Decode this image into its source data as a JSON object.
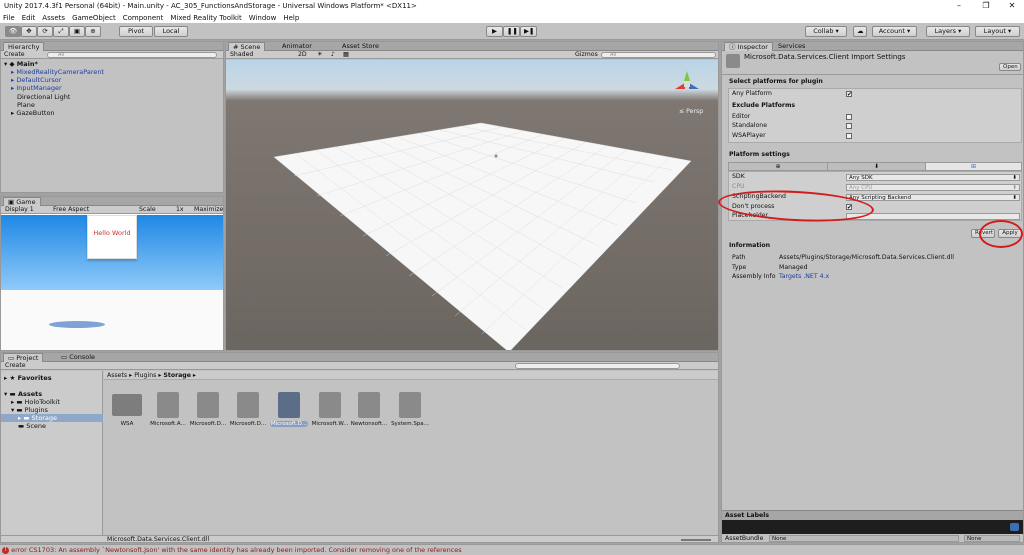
{
  "title": "Unity 2017.4.3f1 Personal (64bit) - Main.unity - AC_305_FunctionsAndStorage - Universal Windows Platform* <DX11>",
  "menu": [
    "File",
    "Edit",
    "Assets",
    "GameObject",
    "Component",
    "Mixed Reality Toolkit",
    "Window",
    "Help"
  ],
  "toolbar": {
    "pivot": "Pivot",
    "local": "Local",
    "collab": "Collab",
    "account": "Account",
    "layers": "Layers",
    "layout": "Layout"
  },
  "hierarchy": {
    "tab": "Hierarchy",
    "create": "Create",
    "search_placeholder": "All",
    "scene": "Main*",
    "items": [
      {
        "label": "MixedRealityCameraParent",
        "blue": true,
        "arrow": true
      },
      {
        "label": "DefaultCursor",
        "blue": true,
        "arrow": true
      },
      {
        "label": "InputManager",
        "blue": true,
        "arrow": true
      },
      {
        "label": "Directional Light",
        "blue": false,
        "arrow": false
      },
      {
        "label": "Plane",
        "blue": false,
        "arrow": false
      },
      {
        "label": "GazeButton",
        "blue": false,
        "arrow": true
      }
    ]
  },
  "game": {
    "tab": "Game",
    "display": "Display 1",
    "aspect": "Free Aspect",
    "scale_label": "Scale",
    "scale_value": "1x",
    "maximize": "Maximize O",
    "hello": "Hello World"
  },
  "scene": {
    "tabs": [
      "Scene",
      "Animator",
      "Asset Store"
    ],
    "shading": "Shaded",
    "mode2d": "2D",
    "gizmos": "Gizmos",
    "search_placeholder": "All",
    "persp": "Persp"
  },
  "project": {
    "tabs": [
      "Project",
      "Console"
    ],
    "create": "Create",
    "tree": [
      {
        "label": "Favorites",
        "bold": true
      },
      {
        "label": "Assets",
        "bold": true
      },
      {
        "label": "HoloToolkit",
        "bold": false
      },
      {
        "label": "Plugins",
        "bold": false
      },
      {
        "label": "Storage",
        "bold": false
      },
      {
        "label": "Scene",
        "bold": false
      }
    ],
    "breadcrumb": [
      "Assets",
      "Plugins",
      "Storage"
    ],
    "assets": [
      "WSA",
      "Microsoft.A...",
      "Microsoft.D...",
      "Microsoft.D...",
      "Microsoft.D...",
      "Microsoft.W...",
      "Newtonsoft...",
      "System.Spa..."
    ],
    "footer_file": "Microsoft.Data.Services.Client.dll"
  },
  "inspector": {
    "tabs": [
      "Inspector",
      "Services"
    ],
    "title": "Microsoft.Data.Services.Client Import Settings",
    "open": "Open",
    "select_header": "Select platforms for plugin",
    "any_platform": "Any Platform",
    "exclude_header": "Exclude Platforms",
    "exclude": [
      "Editor",
      "Standalone",
      "WSAPlayer"
    ],
    "platform_settings": "Platform settings",
    "rows": [
      {
        "label": "SDK",
        "value": "Any SDK"
      },
      {
        "label": "CPU",
        "value": "Any CPU"
      },
      {
        "label": "ScriptingBackend",
        "value": "Any Scripting Backend"
      },
      {
        "label": "Don't process",
        "value": ""
      },
      {
        "label": "Placeholder",
        "value": ""
      }
    ],
    "revert": "Revert",
    "apply": "Apply",
    "info_header": "Information",
    "info": [
      {
        "label": "Path",
        "value": "Assets/Plugins/Storage/Microsoft.Data.Services.Client.dll"
      },
      {
        "label": "Type",
        "value": "Managed"
      },
      {
        "label": "Assembly Info",
        "value": "Targets .NET 4.x"
      }
    ],
    "asset_labels": "Asset Labels",
    "assetbundle": "AssetBundle",
    "none1": "None",
    "none2": "None"
  },
  "status": "error CS1703: An assembly `Newtonsoft.Json' with the same identity has already been imported. Consider removing one of the references",
  "colors": {
    "accent": "#3d6fb6",
    "error": "#d41b1b",
    "link": "#1a3fa8"
  }
}
